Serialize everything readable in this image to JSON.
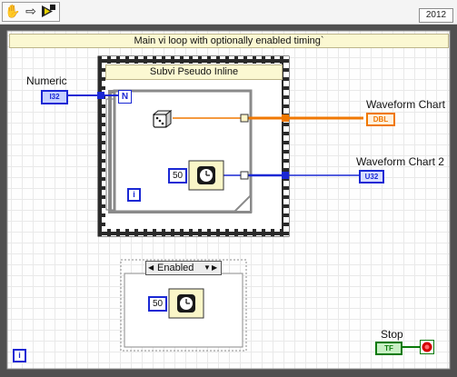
{
  "toolbar": {
    "icons": [
      "hand-icon",
      "run-arrow-icon",
      "broken-run-icon"
    ],
    "version": "2012"
  },
  "main_loop": {
    "title": "Main vi loop with optionally enabled timing`",
    "iteration_label": "i"
  },
  "subvi": {
    "title": "Subvi Pseudo Inline",
    "count_label": "N",
    "iteration_label": "i",
    "random_icon": "dice-icon",
    "wait_icon": "clock-icon",
    "wait_value": "50"
  },
  "numeric": {
    "label": "Numeric",
    "type": "I32"
  },
  "waveform_chart": {
    "label": "Waveform Chart",
    "type": "DBL"
  },
  "waveform_chart_2": {
    "label": "Waveform Chart 2",
    "type": "U32"
  },
  "disable_structure": {
    "selector": "Enabled",
    "wait_value": "50",
    "wait_icon": "clock-icon"
  },
  "stop": {
    "label": "Stop",
    "type": "TF",
    "icon": "stop-icon"
  },
  "colors": {
    "loop_border": "#646464",
    "title_bar": "#fbf8d2",
    "wire_orange": "#f07800",
    "wire_blue": "#1a28d4",
    "wire_green": "#0a7a0a",
    "icon_bg": "#faf6c8"
  }
}
